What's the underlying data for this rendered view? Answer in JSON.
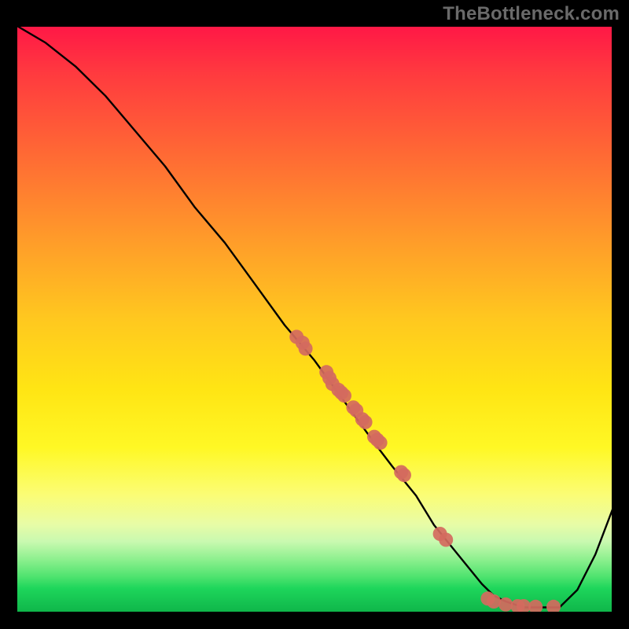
{
  "watermark": "TheBottleneck.com",
  "chart_data": {
    "type": "line",
    "title": "",
    "xlabel": "",
    "ylabel": "",
    "xlim": [
      0,
      100
    ],
    "ylim": [
      0,
      100
    ],
    "curve": {
      "name": "bottleneck-curve",
      "x": [
        0,
        5,
        10,
        15,
        20,
        25,
        30,
        35,
        40,
        45,
        50,
        55,
        60,
        63,
        67,
        70,
        74,
        78,
        80,
        82,
        85,
        88,
        91,
        94,
        97,
        100
      ],
      "y": [
        100,
        97,
        93,
        88,
        82,
        76,
        69,
        63,
        56,
        49,
        43,
        36,
        29,
        25,
        20,
        15,
        10,
        5,
        3,
        2,
        1,
        1,
        1,
        4,
        10,
        18
      ]
    },
    "points": {
      "name": "measurements",
      "color": "#d46a5e",
      "x": [
        47,
        48,
        48.5,
        52,
        52.5,
        53,
        54,
        54.5,
        55,
        56.5,
        57,
        58,
        58.5,
        60,
        60.5,
        61,
        64.5,
        65,
        71,
        72,
        79,
        80,
        82,
        84,
        85,
        87,
        90
      ],
      "y": [
        47,
        46,
        45,
        41,
        40,
        39,
        38,
        37.5,
        37,
        35,
        34.5,
        33,
        32.5,
        30,
        29.5,
        29,
        24,
        23.5,
        13.5,
        12.5,
        2.5,
        2,
        1.5,
        1.2,
        1.2,
        1.1,
        1.1
      ]
    },
    "gradient_stops": [
      {
        "pos": 0.0,
        "color": "#ff1846"
      },
      {
        "pos": 0.5,
        "color": "#ffe514"
      },
      {
        "pos": 0.8,
        "color": "#fbfd75"
      },
      {
        "pos": 1.0,
        "color": "#0fb64a"
      }
    ]
  }
}
